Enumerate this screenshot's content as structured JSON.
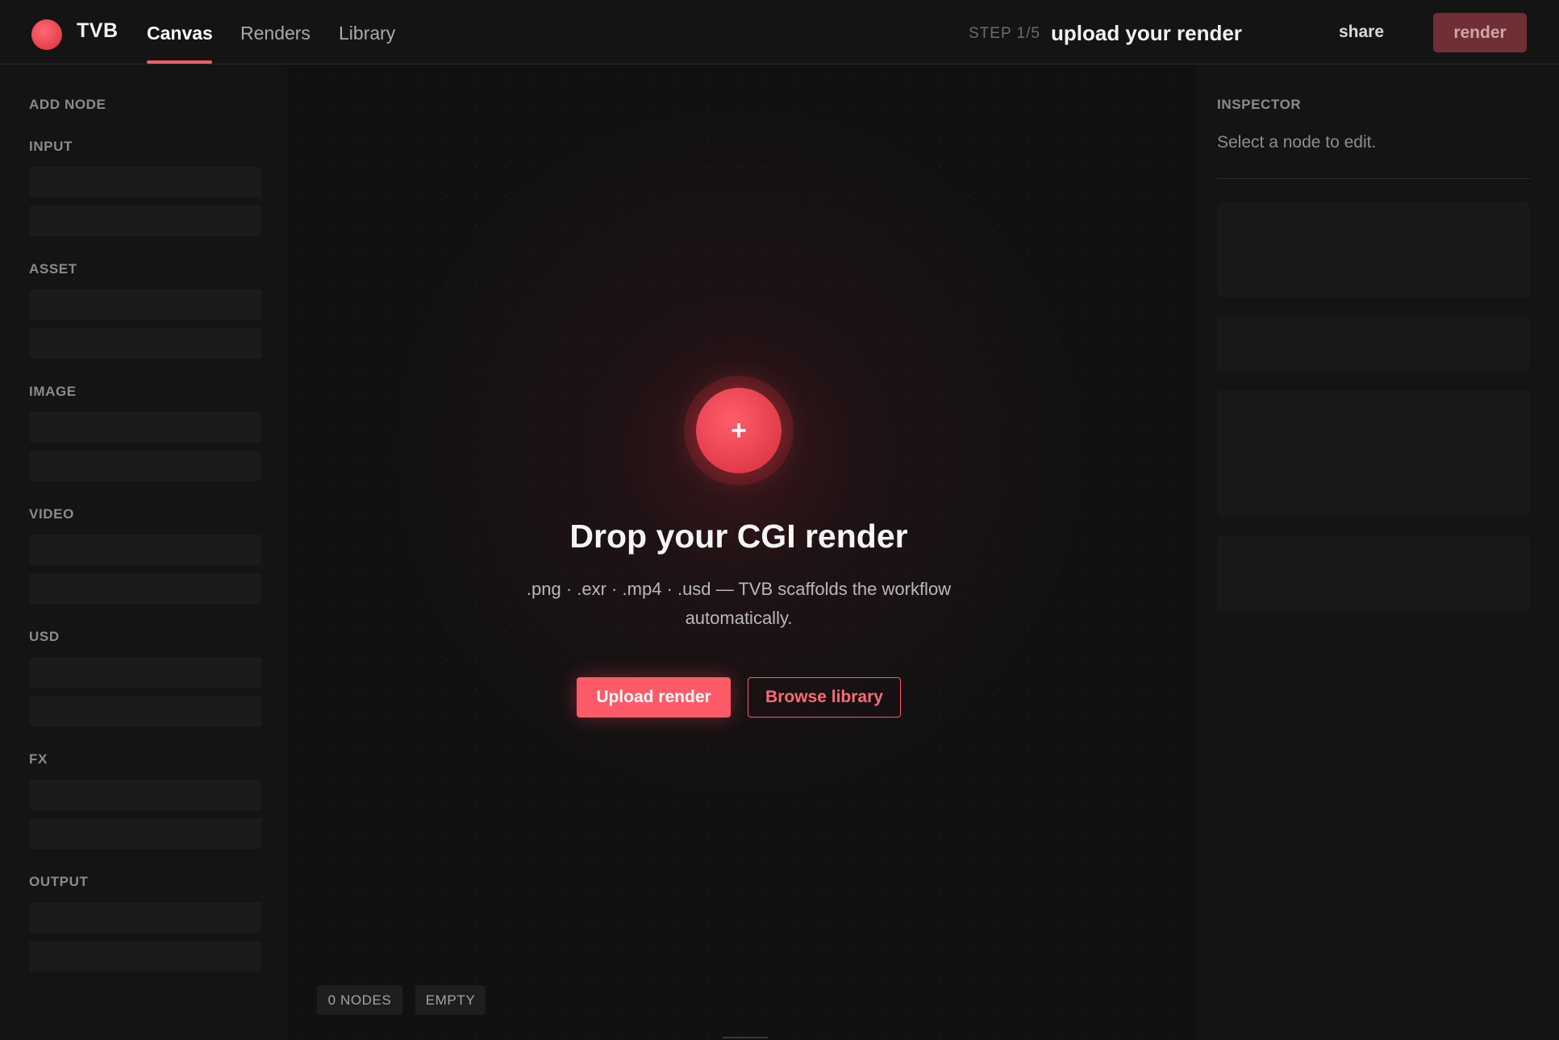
{
  "app": {
    "brand": "TVB",
    "nav_tabs": [
      "Canvas",
      "Renders",
      "Library"
    ],
    "active_tab": "Canvas",
    "step_label": "STEP 1/5",
    "step_title": "upload your render",
    "share_label": "share",
    "render_label": "render"
  },
  "colors": {
    "accent": "#ff5a67",
    "background": "#111112",
    "panel": "#141415"
  },
  "left_panel": {
    "title": "ADD NODE",
    "groups": [
      "INPUT",
      "ASSET",
      "IMAGE",
      "VIDEO",
      "USD",
      "FX",
      "OUTPUT"
    ]
  },
  "canvas": {
    "drop_icon": "plus-icon",
    "drop_glyph": "+",
    "drop_title": "Drop your CGI render",
    "drop_subtitle": ".png · .exr · .mp4 · .usd — TVB scaffolds the workflow automatically.",
    "upload_label": "Upload render",
    "browse_label": "Browse library",
    "node_count": "0 NODES",
    "state": "EMPTY"
  },
  "inspector": {
    "title": "INSPECTOR",
    "hint": "Select a node to edit."
  }
}
